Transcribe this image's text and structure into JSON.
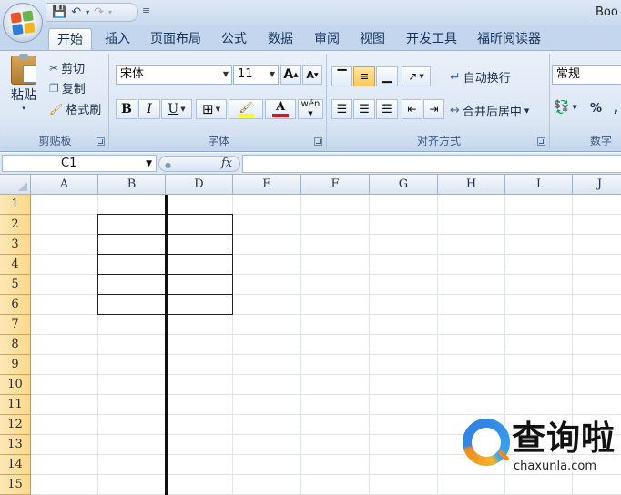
{
  "window": {
    "title": "Boo"
  },
  "quick_access": {
    "save_icon": "save-icon",
    "undo_icon": "undo-icon",
    "redo_icon": "redo-icon",
    "more": "≡"
  },
  "tabs": [
    "开始",
    "插入",
    "页面布局",
    "公式",
    "数据",
    "审阅",
    "视图",
    "开发工具",
    "福昕阅读器"
  ],
  "active_tab": "开始",
  "clipboard": {
    "paste": "粘贴",
    "cut": "剪切",
    "copy": "复制",
    "format_painter": "格式刷",
    "label": "剪贴板"
  },
  "font": {
    "name": "宋体",
    "size": "11",
    "bold": "B",
    "italic": "I",
    "underline": "U",
    "grow": "A",
    "shrink": "A",
    "phonetic": "wén",
    "label": "字体",
    "fill_color": "#ffff00",
    "font_color": "#e0141c"
  },
  "alignment": {
    "wrap_text": "自动换行",
    "merge_center": "合并后居中",
    "label": "对齐方式"
  },
  "number": {
    "format": "常规",
    "percent": "%",
    "comma": ",",
    "label": "数字"
  },
  "formula_bar": {
    "cell_ref": "C1",
    "fx": "fx",
    "value": ""
  },
  "columns": [
    "A",
    "B",
    "D",
    "E",
    "F",
    "G",
    "H",
    "I",
    "J"
  ],
  "rows": [
    "1",
    "2",
    "3",
    "4",
    "5",
    "6",
    "7",
    "8",
    "9",
    "10",
    "11",
    "12",
    "13",
    "14",
    "15"
  ],
  "watermark": {
    "cn": "查询啦",
    "en": "chaxunla.com"
  },
  "colors": {
    "ribbon": "#dce7f5",
    "row_header_selected": "#fbd98c",
    "accent": "#15325c"
  }
}
